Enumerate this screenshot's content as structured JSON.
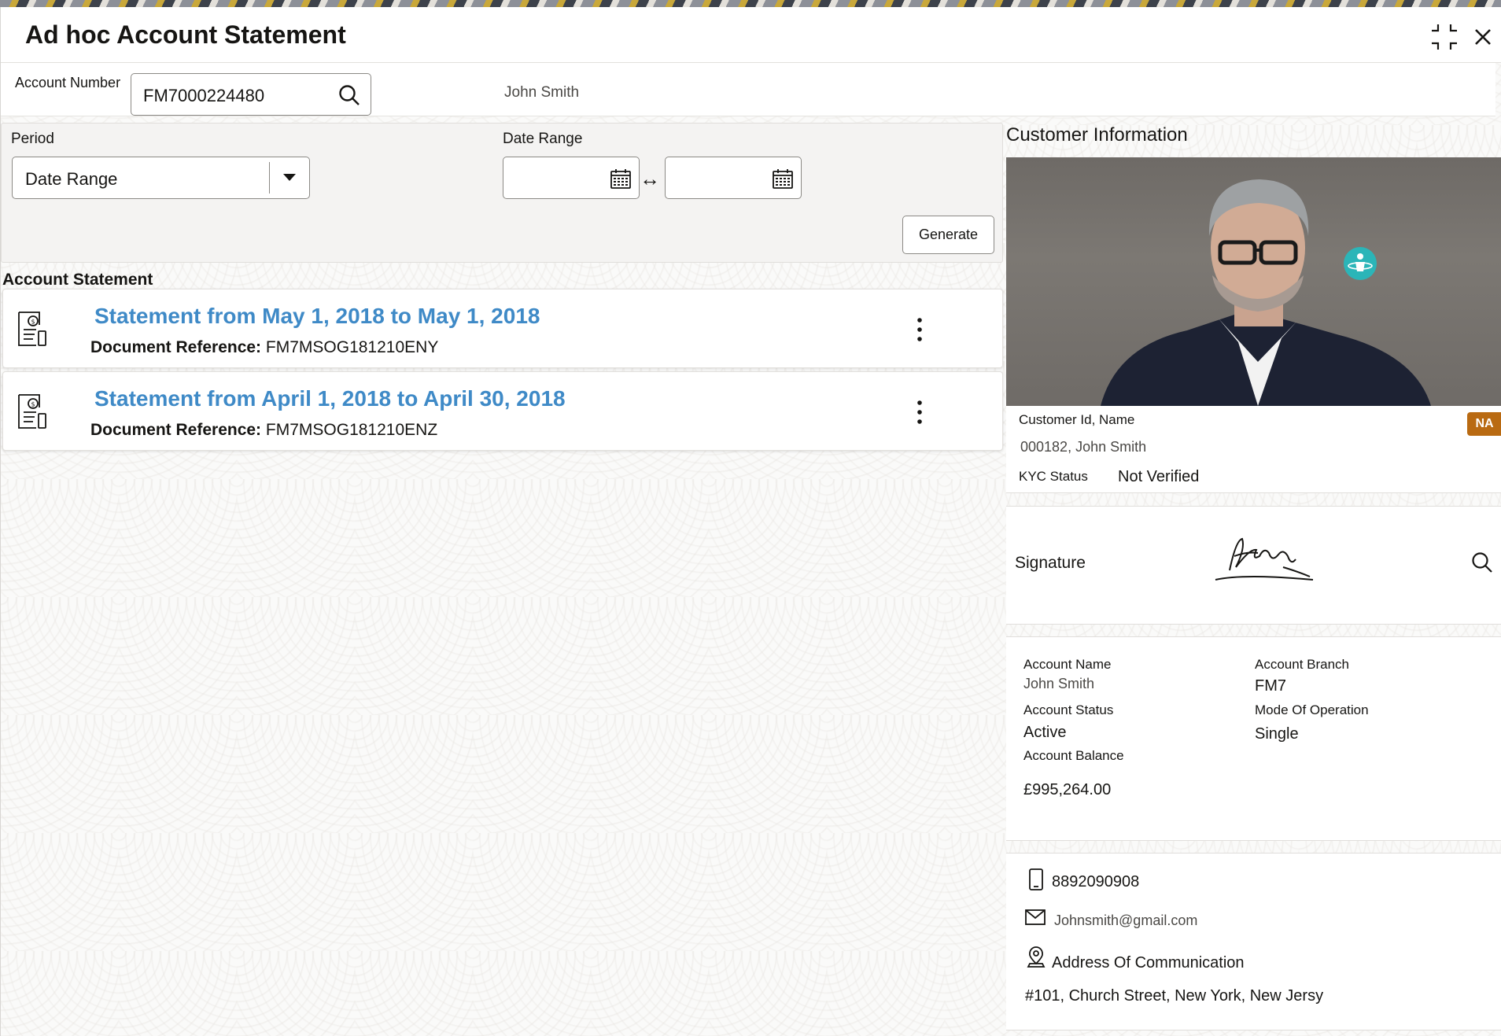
{
  "window": {
    "title": "Ad hoc Account Statement",
    "icons": [
      "compress-icon",
      "close-icon"
    ]
  },
  "account": {
    "label": "Account Number",
    "value": "FM7000224480",
    "holder_name": "John Smith"
  },
  "filters": {
    "period_label": "Period",
    "period_value": "Date Range",
    "date_range_label": "Date Range",
    "from_date": "",
    "to_date": "",
    "range_separator": "↔",
    "generate_label": "Generate"
  },
  "statements": {
    "section_title": "Account Statement",
    "items": [
      {
        "title": "Statement from May 1, 2018 to May 1, 2018",
        "ref_label": "Document Reference:",
        "ref_value": "FM7MSOG181210ENY"
      },
      {
        "title": "Statement from April 1, 2018 to April 30, 2018",
        "ref_label": "Document Reference:",
        "ref_value": "FM7MSOG181210ENZ"
      }
    ]
  },
  "customer": {
    "section_title": "Customer Information",
    "id_name_label": "Customer Id, Name",
    "id_name_value": "000182, John Smith",
    "badge": "NA",
    "kyc_label": "KYC Status",
    "kyc_value": "Not Verified",
    "signature_label": "Signature"
  },
  "account_details": {
    "name_label": "Account Name",
    "name_value": "John Smith",
    "branch_label": "Account Branch",
    "branch_value": "FM7",
    "status_label": "Account Status",
    "status_value": "Active",
    "mode_label": "Mode Of Operation",
    "mode_value": "Single",
    "balance_label": "Account Balance",
    "balance_value": "£995,264.00"
  },
  "contact": {
    "phone": "8892090908",
    "email": "Johnsmith@gmail.com",
    "address_label": "Address Of Communication",
    "address_value": "#101, Church Street, New York, New Jersy"
  },
  "colors": {
    "link_blue": "#3f8ac7",
    "badge_orange": "#b96a12",
    "accent_teal": "#2bb5b8"
  }
}
